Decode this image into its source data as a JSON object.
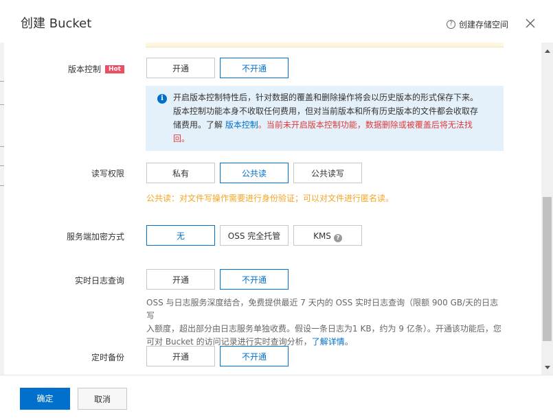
{
  "dialog": {
    "title": "创建 Bucket",
    "help_label": "创建存储空间",
    "help_icon": "question-circle-icon",
    "close_icon": "close-icon"
  },
  "versioning": {
    "label": "版本控制",
    "badge": "Hot",
    "options": [
      "开通",
      "不开通"
    ],
    "selected": "不开通",
    "info_icon": "info-icon",
    "info_text_1": "开启版本控制特性后，针对数据的覆盖和删除操作将会以历史版本的形式保存下来。",
    "info_text_2": "版本控制功能本身不收取任何费用，但对当前版本和所有历史版本的文件都会收取存",
    "info_text_3": "储费用。了解 ",
    "info_link": "版本控制",
    "info_warning_1": "。当前未开启版本控制功能，数据删除或被覆盖后将无法找",
    "info_warning_2": "回。"
  },
  "acl": {
    "label": "读写权限",
    "options": [
      "私有",
      "公共读",
      "公共读写"
    ],
    "selected": "公共读",
    "warning": "公共读：对文件写操作需要进行身份验证；可以对文件进行匿名读。"
  },
  "encryption": {
    "label": "服务端加密方式",
    "options": [
      "无",
      "OSS 完全托管",
      "KMS"
    ],
    "selected": "无",
    "kms_help_icon": "question-circle-icon"
  },
  "realtime_log": {
    "label": "实时日志查询",
    "options": [
      "开通",
      "不开通"
    ],
    "selected": "不开通",
    "desc_1": "OSS 与日志服务深度结合，免费提供最近 7 天内的 OSS 实时日志查询（限额 900 GB/天的日志写",
    "desc_2": "入额度，超出部分由日志服务单独收费。假设一条日志为1 KB，约为 9 亿条）。开通该功能后，您",
    "desc_3": "可对 Bucket 的访问记录进行实时查询分析，",
    "desc_link": "了解详情",
    "desc_end": "。"
  },
  "scheduled_backup": {
    "label": "定时备份",
    "options": [
      "开通",
      "不开通"
    ],
    "selected": "不开通"
  },
  "footer": {
    "confirm": "确定",
    "cancel": "取消"
  },
  "colors": {
    "primary": "#0070cc",
    "hot_badge": "#ec4f63",
    "warning_text": "#f5a623",
    "danger_text": "#e03a3a",
    "info_bg": "#e4f1fb"
  }
}
